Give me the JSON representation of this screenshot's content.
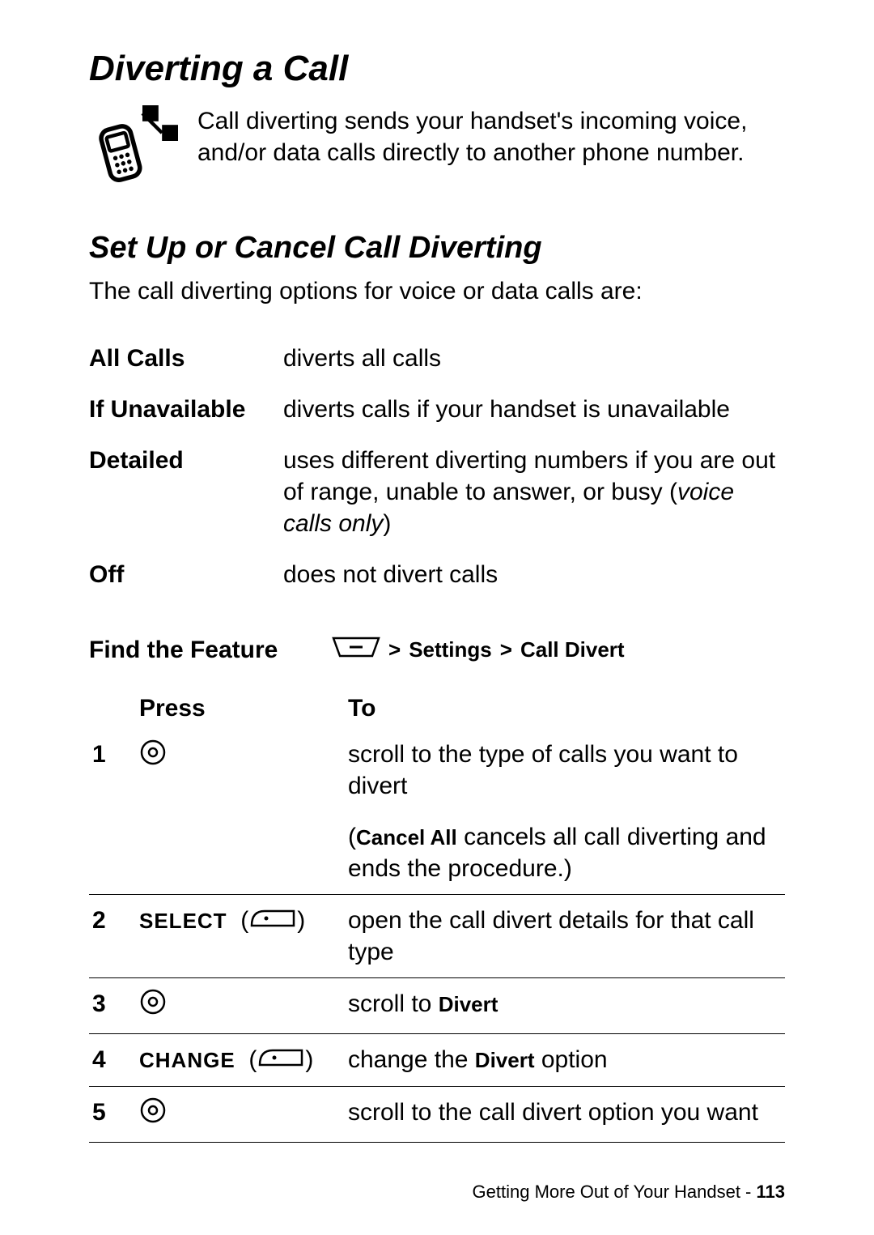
{
  "title": "Diverting a Call",
  "intro": "Call diverting sends your handset's incoming voice, and/or data calls directly to another phone number.",
  "subheading": "Set Up or Cancel Call Diverting",
  "sub_intro": "The call diverting options for voice or data calls are:",
  "options": [
    {
      "label": "All Calls",
      "desc_plain": "diverts all calls"
    },
    {
      "label": "If Unavailable",
      "desc_plain": "diverts calls if your handset is unavailable"
    },
    {
      "label": "Detailed",
      "desc_before": "uses different diverting numbers if you are out of range, unable to answer, or busy (",
      "desc_italic": "voice calls only",
      "desc_after": ")"
    },
    {
      "label": "Off",
      "desc_plain": "does not divert calls"
    }
  ],
  "find_feature_label": "Find the Feature",
  "find_path_sep": " > ",
  "find_path_a": "Settings",
  "find_path_b": "Call Divert",
  "steps_head_press": "Press",
  "steps_head_to": "To",
  "steps": {
    "s1_num": "1",
    "s1_to": "scroll to the type of calls you want to divert",
    "s1b_open": "(",
    "s1b_strong": "Cancel All",
    "s1b_rest": " cancels all call diverting and ends the procedure.)",
    "s2_num": "2",
    "s2_press": "SELECT",
    "s2_to": "open the call divert details for that call type",
    "s3_num": "3",
    "s3_to_a": "scroll to ",
    "s3_to_b": "Divert",
    "s4_num": "4",
    "s4_press": "CHANGE",
    "s4_to_a": "change the ",
    "s4_to_b": "Divert",
    "s4_to_c": " option",
    "s5_num": "5",
    "s5_to": "scroll to the call divert option you want"
  },
  "footer_text": "Getting More Out of Your Handset - ",
  "footer_page": "113",
  "icons": {
    "phone": "phone-divert-icon",
    "menu": "menu-key-icon",
    "nav": "nav-key-icon",
    "soft": "soft-key-icon"
  }
}
